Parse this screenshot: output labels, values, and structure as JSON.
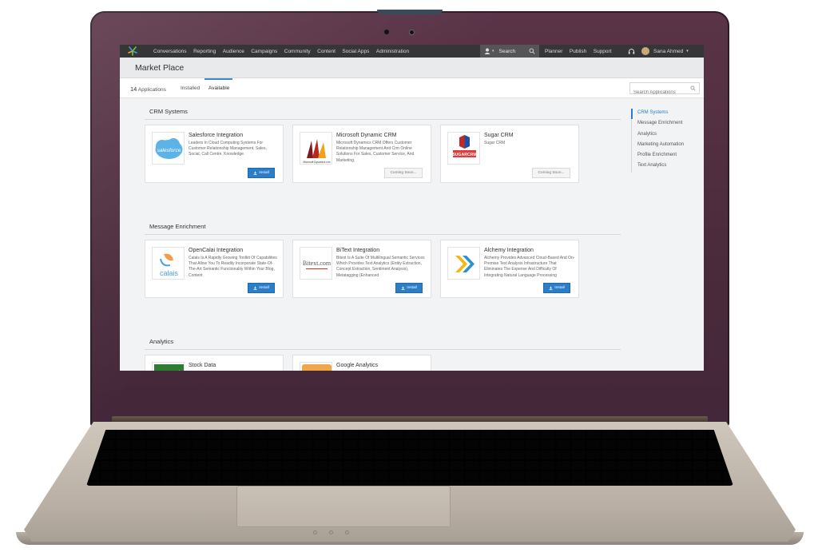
{
  "topnav": {
    "items": [
      "Conversations",
      "Reporting",
      "Audience",
      "Campaigns",
      "Community",
      "Content",
      "Social Apps",
      "Administration"
    ],
    "search_label": "Search",
    "right_items": [
      "Planner",
      "Publish",
      "Support"
    ],
    "user_name": "Sana Ahmed"
  },
  "page": {
    "title": "Market Place"
  },
  "tabs": {
    "count_number": "14",
    "count_label": "Applications",
    "installed": "Installed",
    "available": "Available"
  },
  "search": {
    "placeholder": "Search Applications"
  },
  "sections": [
    {
      "title": "CRM Systems",
      "cards": [
        {
          "name": "Salesforce Integration",
          "desc": "Leaders In Cloud Computing Systems For Customer Relationship Management, Sales, Social, Call Centre, Knowledge.",
          "action": "Install",
          "logo_text": "salesforce"
        },
        {
          "name": "Microsoft Dynamic CRM",
          "desc": "Microsoft Dynamics CRM Offers Customer Relationship Management And Crm Online Solutions For Sales, Customer Service, And Marketing.",
          "action": "Coming Soon...",
          "logo_text": "Microsoft Dynamics crm"
        },
        {
          "name": "Sugar CRM",
          "desc": "Sugar CRM",
          "action": "Coming Soon...",
          "logo_text": "SUGARCRM"
        }
      ]
    },
    {
      "title": "Message Enrichment",
      "cards": [
        {
          "name": "OpenCalai Integration",
          "desc": "Calais Is A Rapidly Growing Toolkit Of Capabilities That Allow You To Readily Incorporate State-Of-The-Art Semantic Functionality Within Your Blog, Content",
          "action": "Install",
          "logo_text": "calais"
        },
        {
          "name": "BiText Integration",
          "desc": "Bitext Is A Suite Of Multilingual Semantic Services Which Provides Text Analytics (Entity Extraction, Concept Extraction, Sentiment Analysis), Metatagging (Enhanced",
          "action": "Install",
          "logo_text": "Bitext.com"
        },
        {
          "name": "Alchemy Integration",
          "desc": "Alchemy Provides Advanced Cloud-Based And On-Premise Text Analysis Infrastructure That Eliminates The Expense And Difficulty Of Integrating Natural Language Processing",
          "action": "Install",
          "logo_text": ""
        }
      ]
    },
    {
      "title": "Analytics",
      "cards": [
        {
          "name": "Stock Data",
          "desc": "",
          "action": "",
          "logo_text": ""
        },
        {
          "name": "Google Analytics",
          "desc": "",
          "action": "",
          "logo_text": ""
        }
      ]
    }
  ],
  "sidenav": [
    "CRM Systems",
    "Message Enrichment",
    "Analytics",
    "Marketing Automation",
    "Profile Enrichment",
    "Text Analytics"
  ],
  "colors": {
    "accent": "#2a7dc6",
    "topnav_bg": "#363636",
    "lid": "#4a2b3b"
  }
}
